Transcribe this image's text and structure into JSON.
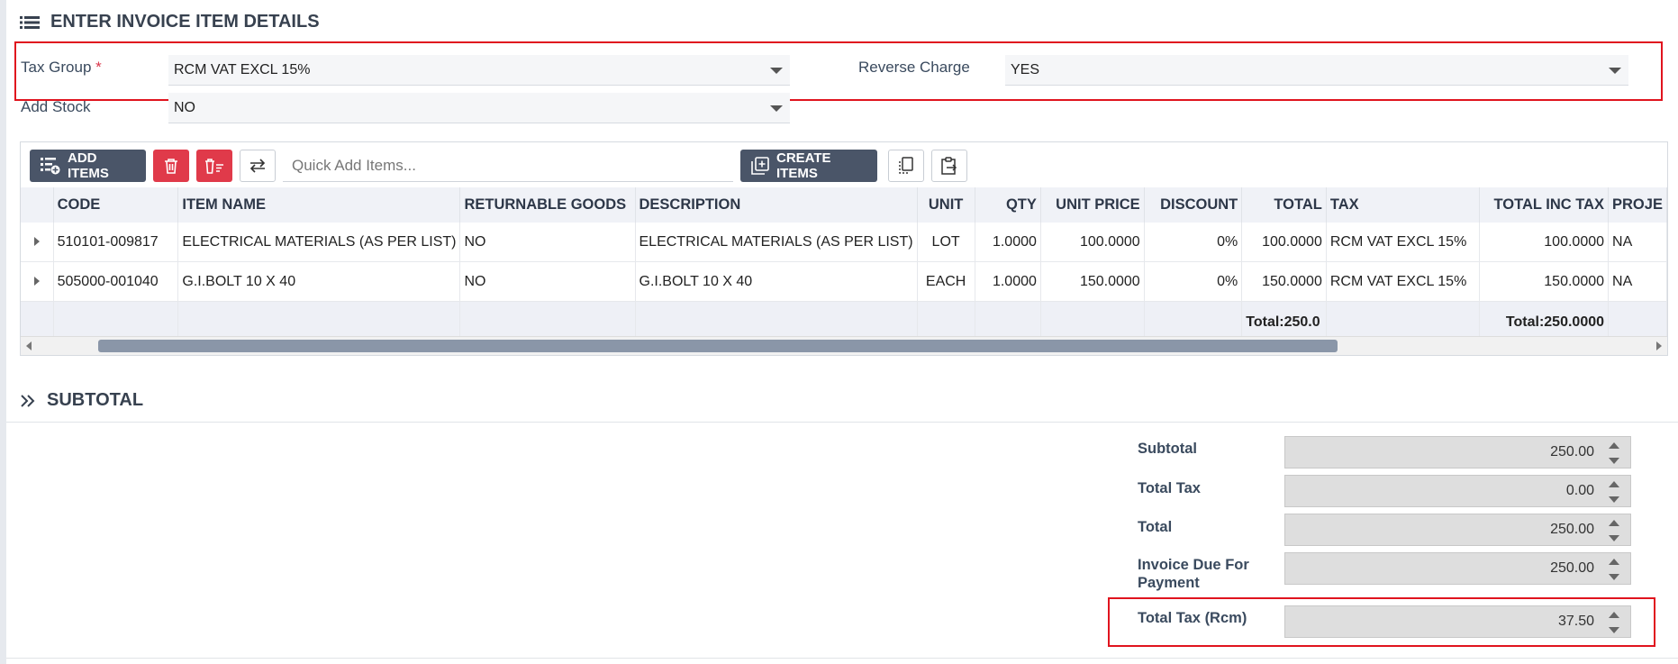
{
  "section_items": {
    "title": "ENTER INVOICE ITEM DETAILS"
  },
  "form": {
    "tax_group_label": "Tax Group",
    "required_mark": "*",
    "tax_group_value": "RCM VAT EXCL 15%",
    "reverse_charge_label": "Reverse Charge",
    "reverse_charge_value": "YES",
    "add_stock_label": "Add Stock",
    "add_stock_value": "NO"
  },
  "toolbar": {
    "add_items_label": "ADD ITEMS",
    "quick_add_placeholder": "Quick Add Items...",
    "create_items_label": "CREATE ITEMS"
  },
  "grid": {
    "headers": {
      "code": "CODE",
      "item_name": "ITEM NAME",
      "returnable": "RETURNABLE GOODS",
      "description": "DESCRIPTION",
      "unit": "UNIT",
      "qty": "QTY",
      "unit_price": "UNIT PRICE",
      "discount": "DISCOUNT",
      "total": "TOTAL",
      "tax": "TAX",
      "total_inc_tax": "TOTAL INC TAX",
      "project": "PROJE"
    },
    "rows": [
      {
        "code": "510101-009817",
        "item_name": "ELECTRICAL MATERIALS (AS PER LIST)",
        "returnable": "NO",
        "description": "ELECTRICAL MATERIALS (AS PER LIST)",
        "unit": "LOT",
        "qty": "1.0000",
        "unit_price": "100.0000",
        "discount": "0%",
        "total": "100.0000",
        "tax": "RCM VAT EXCL 15%",
        "total_inc_tax": "100.0000",
        "project": "NA"
      },
      {
        "code": "505000-001040",
        "item_name": "G.I.BOLT 10 X 40",
        "returnable": "NO",
        "description": "G.I.BOLT 10 X 40",
        "unit": "EACH",
        "qty": "1.0000",
        "unit_price": "150.0000",
        "discount": "0%",
        "total": "150.0000",
        "tax": "RCM VAT EXCL 15%",
        "total_inc_tax": "150.0000",
        "project": "NA"
      }
    ],
    "footer": {
      "total": "Total:250.0",
      "total_inc_tax": "Total:250.0000"
    },
    "scrollbar_position_fraction": 0.16
  },
  "section_subtotal": {
    "title": "SUBTOTAL"
  },
  "summary": {
    "subtotal_label": "Subtotal",
    "subtotal_value": "250.00",
    "total_tax_label": "Total Tax",
    "total_tax_value": "0.00",
    "total_label": "Total",
    "total_value": "250.00",
    "due_label_line1": "Invoice Due For",
    "due_label_line2": "Payment",
    "due_value": "250.00",
    "rcm_label": "Total Tax (Rcm)",
    "rcm_value": "37.50"
  },
  "colors": {
    "highlight": "#e0141e",
    "danger": "#e03a4a",
    "dark_button": "#4a5568"
  }
}
